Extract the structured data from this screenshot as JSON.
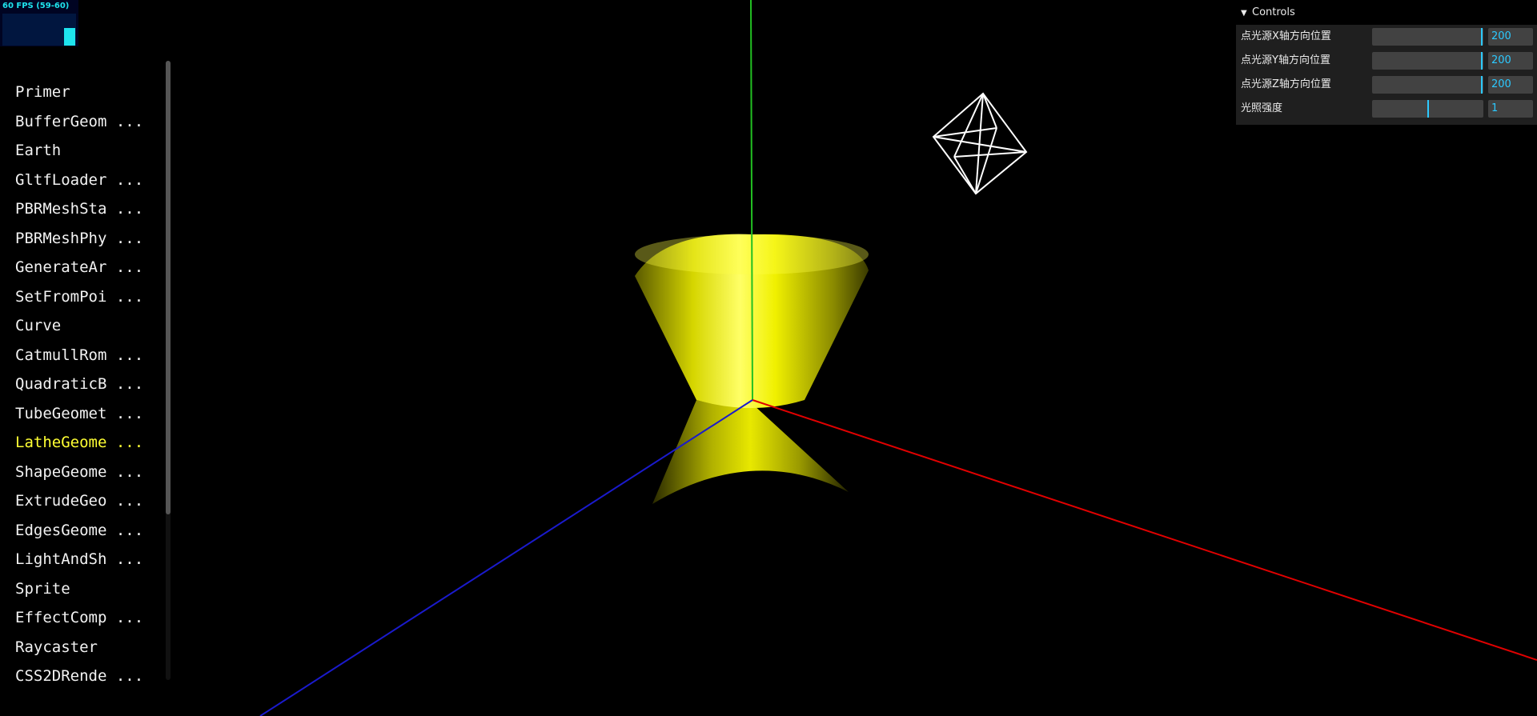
{
  "stats": {
    "fps_label": "60 FPS (59-60)",
    "fps_level": 0.55,
    "color": "#1ee4ee"
  },
  "sidebar": {
    "items": [
      {
        "label": "Primer"
      },
      {
        "label": "BufferGeom ..."
      },
      {
        "label": "Earth"
      },
      {
        "label": "GltfLoader ..."
      },
      {
        "label": "PBRMeshSta ..."
      },
      {
        "label": "PBRMeshPhy ..."
      },
      {
        "label": "GenerateAr ..."
      },
      {
        "label": "SetFromPoi ..."
      },
      {
        "label": "Curve"
      },
      {
        "label": "CatmullRom ..."
      },
      {
        "label": "QuadraticB ..."
      },
      {
        "label": "TubeGeomet ..."
      },
      {
        "label": "LatheGeome ...",
        "active": true
      },
      {
        "label": "ShapeGeome ..."
      },
      {
        "label": "ExtrudeGeo ..."
      },
      {
        "label": "EdgesGeome ..."
      },
      {
        "label": "LightAndSh ..."
      },
      {
        "label": "Sprite"
      },
      {
        "label": "EffectComp ..."
      },
      {
        "label": "Raycaster"
      },
      {
        "label": "CSS2DRende ..."
      }
    ],
    "active_color": "#ffff33"
  },
  "controls": {
    "title": "Controls",
    "accent": "#2cc9ff",
    "rows": [
      {
        "label": "点光源X轴方向位置",
        "value": "200",
        "level": 0.99
      },
      {
        "label": "点光源Y轴方向位置",
        "value": "200",
        "level": 0.99
      },
      {
        "label": "点光源Z轴方向位置",
        "value": "200",
        "level": 0.99
      },
      {
        "label": "光照强度",
        "value": "1",
        "level": 0.5
      }
    ]
  },
  "scene": {
    "axis_colors": {
      "x": "#e00000",
      "y": "#22c022",
      "z": "#1a1acc"
    },
    "mesh_color": "#ffff00",
    "light_helper_color": "#ffffff"
  }
}
